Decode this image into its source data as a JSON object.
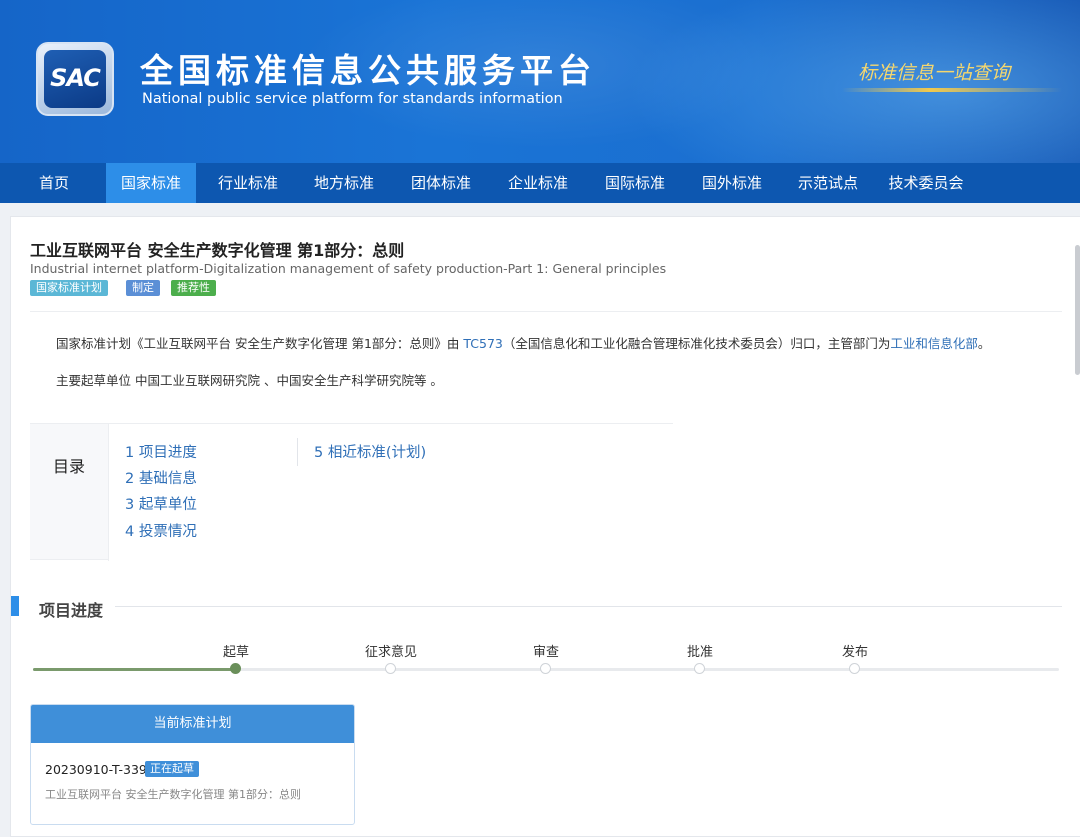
{
  "header": {
    "logo_text": "SAC",
    "title": "全国标准信息公共服务平台",
    "subtitle": "National public service platform  for standards information",
    "slogan": "标准信息一站查询"
  },
  "nav": {
    "items": [
      "首页",
      "国家标准",
      "行业标准",
      "地方标准",
      "团体标准",
      "企业标准",
      "国际标准",
      "国外标准",
      "示范试点",
      "技术委员会"
    ],
    "active": "国家标准"
  },
  "standard": {
    "title_cn": "工业互联网平台 安全生产数字化管理 第1部分：总则",
    "title_en": "Industrial internet platform-Digitalization management of safety production-Part 1: General principles",
    "tags": [
      {
        "label": "国家标准计划",
        "color": "#5bb7d6"
      },
      {
        "label": "制定",
        "color": "#5b8fd6"
      },
      {
        "label": "推荐性",
        "color": "#4cae4c"
      }
    ],
    "desc1_pre": "国家标准计划《工业互联网平台 安全生产数字化管理 第1部分：总则》由 ",
    "desc1_tc": "TC573",
    "desc1_mid": "（全国信息化和工业化融合管理标准化技术委员会）归口，主管部门为",
    "desc1_dept": "工业和信息化部",
    "desc1_end": "。",
    "desc2": "主要起草单位 中国工业互联网研究院 、中国安全生产科学研究院等 。"
  },
  "toc": {
    "label": "目录",
    "items": [
      "1  项目进度",
      "2  基础信息",
      "3  起草单位",
      "4  投票情况",
      "5  相近标准(计划)"
    ]
  },
  "progress": {
    "section_title": "项目进度",
    "steps": [
      "起草",
      "征求意见",
      "审查",
      "批准",
      "发布"
    ],
    "current_step": 1
  },
  "plan": {
    "header": "当前标准计划",
    "code": "20230910-T-339",
    "status": "正在起草",
    "name": "工业互联网平台 安全生产数字化管理 第1部分：总则"
  },
  "colors": {
    "banner": "#1a74d6",
    "nav": "#0d57b0",
    "nav_active": "#2d8ee8",
    "link": "#2f6fb7",
    "progress_done": "#6a8f5a"
  }
}
